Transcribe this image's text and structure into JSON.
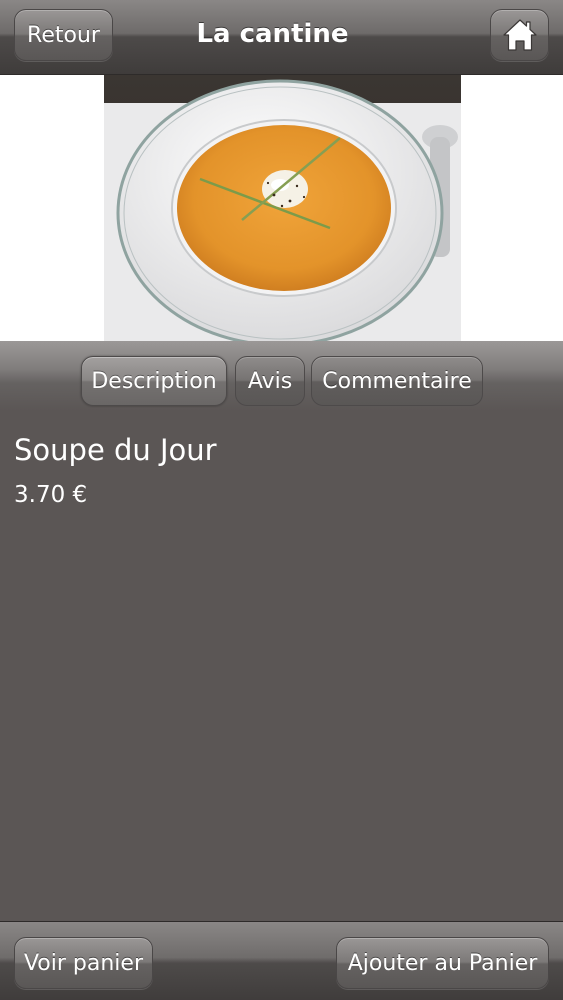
{
  "header": {
    "back_label": "Retour",
    "title": "La cantine",
    "home_icon": "home-icon"
  },
  "tabs": [
    {
      "label": "Description",
      "active": true
    },
    {
      "label": "Avis",
      "active": false
    },
    {
      "label": "Commentaire",
      "active": false
    }
  ],
  "product": {
    "name": "Soupe du Jour",
    "price": "3.70 €"
  },
  "footer": {
    "view_cart_label": "Voir panier",
    "add_to_cart_label": "Ajouter au Panier"
  },
  "colors": {
    "content_background": "#5b5655",
    "soup": "#e89a2e",
    "text": "#ffffff"
  }
}
